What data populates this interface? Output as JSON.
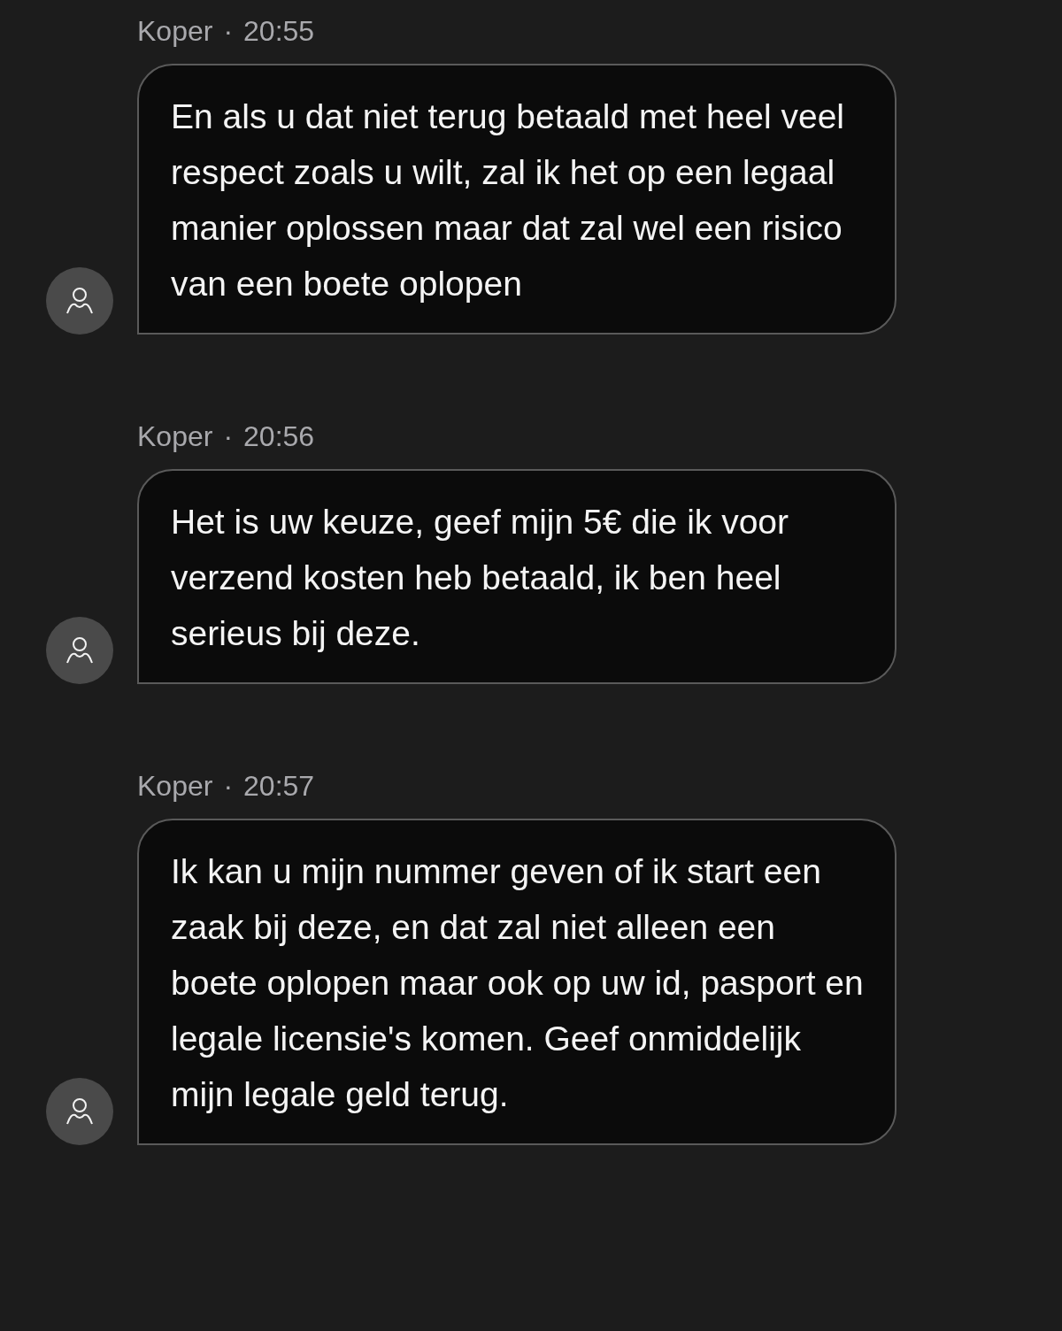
{
  "messages": [
    {
      "sender": "Koper",
      "separator": "·",
      "time": "20:55",
      "text": "En als u dat niet terug betaald met heel veel respect zoals u wilt, zal ik het op een legaal manier oplossen maar dat zal wel een risico van een boete oplopen"
    },
    {
      "sender": "Koper",
      "separator": "·",
      "time": "20:56",
      "text": "Het is uw keuze, geef mijn 5€ die ik voor verzend kosten heb betaald, ik ben heel serieus bij deze."
    },
    {
      "sender": "Koper",
      "separator": "·",
      "time": "20:57",
      "text": "Ik kan u mijn nummer geven of ik start een zaak bij deze, en dat zal niet alleen een boete oplopen maar ook op uw id, pasport en legale licensie's komen. Geef onmiddelijk mijn legale geld terug."
    }
  ]
}
